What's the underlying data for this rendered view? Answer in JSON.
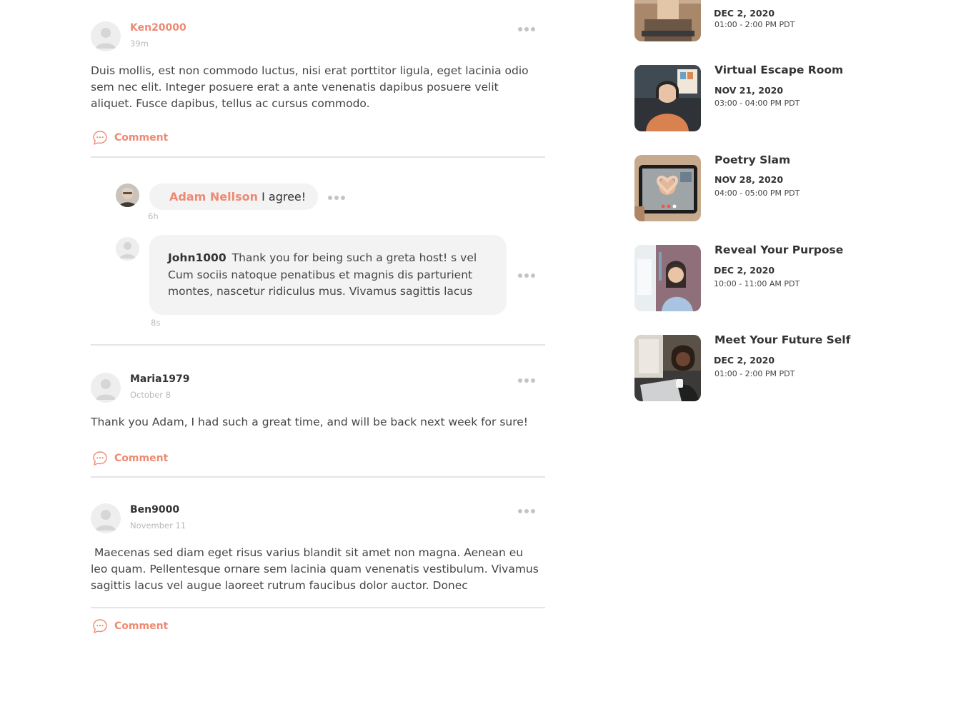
{
  "colors": {
    "accent": "#ee8a72",
    "text": "#333333",
    "muted": "#b9b9b9",
    "bubble": "#f3f3f3",
    "divider": "#e5e5e5"
  },
  "feed": {
    "posts": [
      {
        "username": "Ken20000",
        "time": "39m",
        "text": "Duis mollis, est non commodo luctus, nisi erat porttitor ligula, eget lacinia odio sem nec elit. Integer posuere erat a ante venenatis dapibus posuere velit aliquet. Fusce dapibus, tellus ac cursus commodo.",
        "comment_label": "Comment",
        "replies": [
          {
            "username": "Adam Nellson",
            "text": "I agree!",
            "time": "6h"
          },
          {
            "username": "John1000",
            "text": "Thank you for being such a greta host! s vel Cum sociis natoque penatibus et magnis dis parturient montes, nascetur ridiculus mus. Vivamus sagittis lacus",
            "time": "8s"
          }
        ]
      },
      {
        "username": "Maria1979",
        "time": "October 8",
        "text": "Thank you Adam, I had such a great time, and will be back next week for sure!",
        "comment_label": "Comment"
      },
      {
        "username": "Ben9000",
        "time": "November 11",
        "text": " Maecenas sed diam eget risus varius blandit sit amet non magna. Aenean eu leo quam. Pellentesque ornare sem lacinia quam venenatis vestibulum. Vivamus sagittis lacus vel augue laoreet rutrum faucibus dolor auctor. Donec",
        "comment_label": "Comment"
      }
    ]
  },
  "events": [
    {
      "title": "",
      "date": "DEC 2, 2020",
      "time": "01:00 - 2:00 PM PDT",
      "thumb": "man-laptop-photo"
    },
    {
      "title": "Virtual Escape Room",
      "date": "NOV 21, 2020",
      "time": "03:00 - 04:00 PM PDT",
      "thumb": "woman-headphones-photo"
    },
    {
      "title": "Poetry Slam",
      "date": "NOV 28, 2020",
      "time": "04:00 - 05:00 PM PDT",
      "thumb": "tablet-video-call-photo"
    },
    {
      "title": "Reveal Your Purpose",
      "date": "DEC 2, 2020",
      "time": "10:00 - 11:00 AM PDT",
      "thumb": "woman-headset-photo"
    },
    {
      "title": "Meet Your Future Self",
      "date": "DEC 2, 2020",
      "time": "01:00 - 2:00 PM PDT",
      "thumb": "woman-coffee-laptop-photo"
    }
  ]
}
